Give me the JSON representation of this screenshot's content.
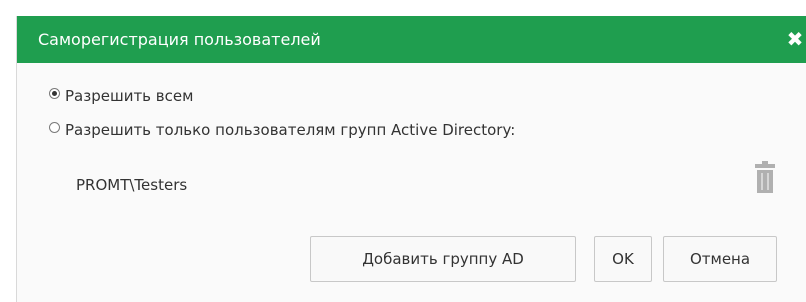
{
  "dialog": {
    "title": "Саморегистрация пользователей",
    "close_symbol": "✖",
    "options": [
      {
        "label": "Разрешить всем",
        "checked": true
      },
      {
        "label": "Разрешить только пользователям групп Active Directory:",
        "checked": false
      }
    ],
    "groups": [
      {
        "name": "PROMT\\Testers"
      }
    ],
    "buttons": {
      "add_group": "Добавить группу AD",
      "ok": "OK",
      "cancel": "Отмена"
    }
  },
  "colors": {
    "titlebar": "#1f9e4f",
    "trash_icon": "#b0b0b0"
  },
  "icons": {
    "close": "close-icon",
    "delete": "trash-icon"
  }
}
